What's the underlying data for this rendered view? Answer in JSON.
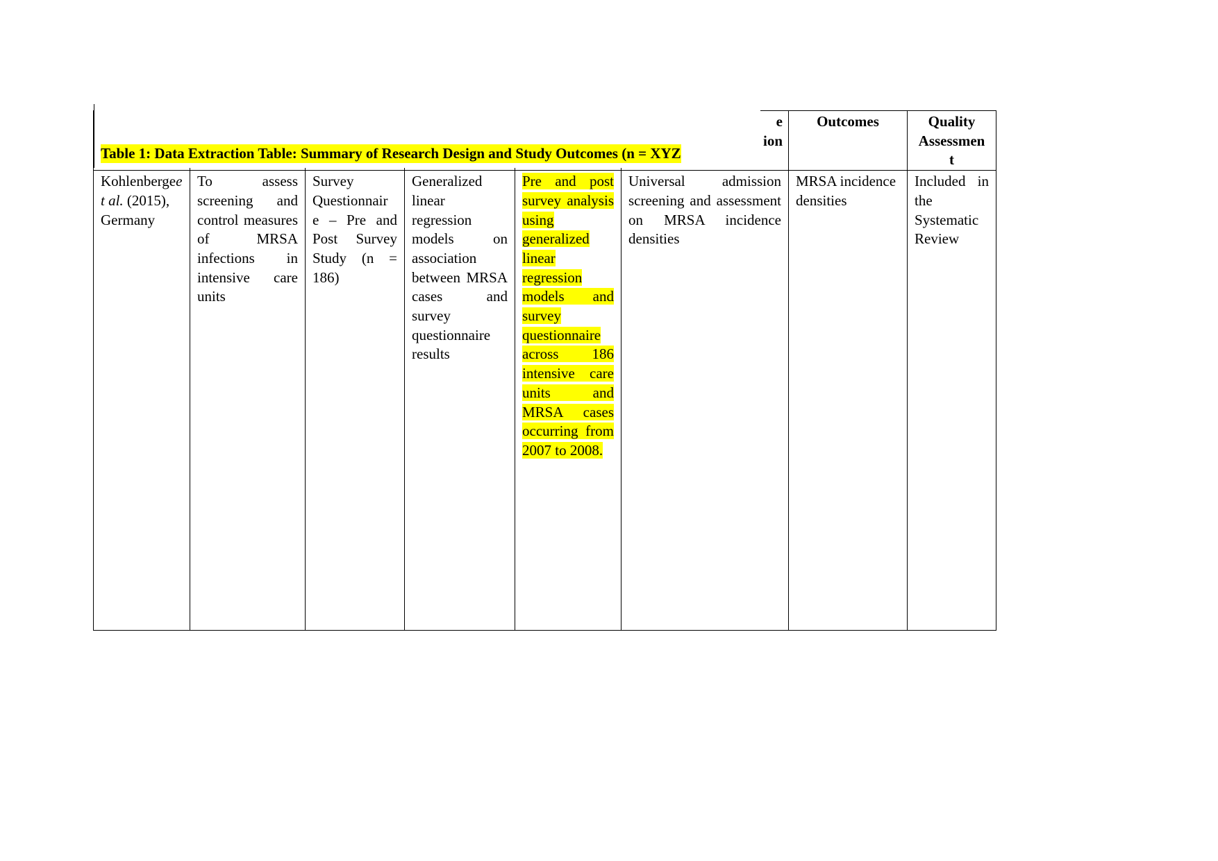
{
  "caption": "Table 1: Data Extraction Table: Summary of Research Design and Study Outcomes (n = XYZ",
  "headers": {
    "intervention_line1": "e",
    "intervention_line2": "ion",
    "outcomes": "Outcomes",
    "quality": "Quality Assessmen t"
  },
  "row": {
    "study_a": "Kohlenberge",
    "study_b": "t al.",
    "study_c": " (2015), Germany",
    "aim": "To assess screening and control measures of MRSA infections in intensive care units",
    "design": "Survey Questionnair e – Pre and Post Survey Study (n = 186)",
    "analysis": "Generalized linear regression models on association between MRSA cases and survey questionnaire results",
    "method": "Pre and post survey analysis using generalized linear regression models and survey questionnaire across 186 intensive care units and MRSA cases occurring from 2007 to 2008.",
    "intervention": "Universal admission screening and assessment on MRSA incidence densities",
    "outcomes": "MRSA incidence densities",
    "quality": "Included in the Systematic Review"
  },
  "highlight_color": "#ffff00"
}
